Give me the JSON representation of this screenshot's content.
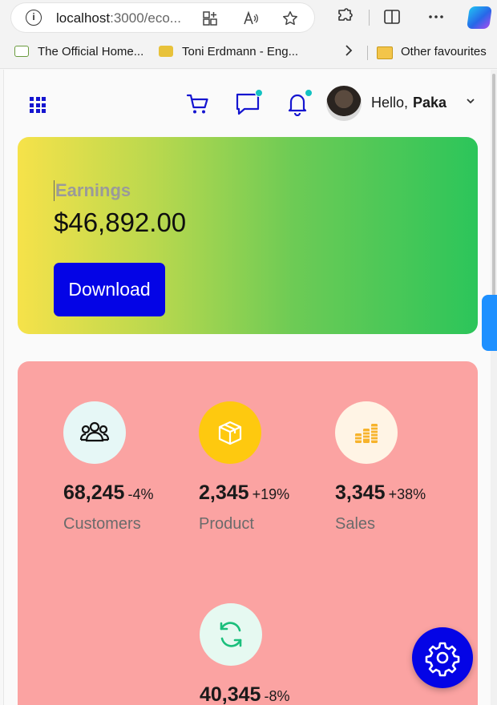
{
  "browser": {
    "url_host": "localhost",
    "url_rest": ":3000/eco...",
    "bookmarks": [
      {
        "label": "The Official Home...",
        "icon": "vts-favicon"
      },
      {
        "label": "Toni Erdmann - Eng...",
        "icon": "subtitle-favicon"
      }
    ],
    "other_favourites": "Other favourites"
  },
  "header": {
    "greeting": "Hello,",
    "username": "Paka",
    "icons": [
      "apps-grid-icon",
      "cart-icon",
      "chat-icon",
      "bell-icon"
    ]
  },
  "earnings": {
    "label": "Earnings",
    "value": "$46,892.00",
    "button": "Download"
  },
  "stats": [
    {
      "value": "68,245",
      "change": "-4%",
      "label": "Customers",
      "icon": "users-icon",
      "bg": "#e6f7f6",
      "fg": "#111111"
    },
    {
      "value": "2,345",
      "change": "+19%",
      "label": "Product",
      "icon": "box-icon",
      "bg": "#fec90f",
      "fg": "#ffffff"
    },
    {
      "value": "3,345",
      "change": "+38%",
      "label": "Sales",
      "icon": "coins-icon",
      "bg": "#fff4e5",
      "fg": "#f7b32b"
    },
    {
      "value": "40,345",
      "change": "-8%",
      "label": "",
      "icon": "refresh-icon",
      "bg": "#e6f9f1",
      "fg": "#1bbf7c"
    }
  ],
  "colors": {
    "primary": "#0404e6",
    "accent_dot": "#13c2c2",
    "stats_bg": "#fba3a2"
  }
}
